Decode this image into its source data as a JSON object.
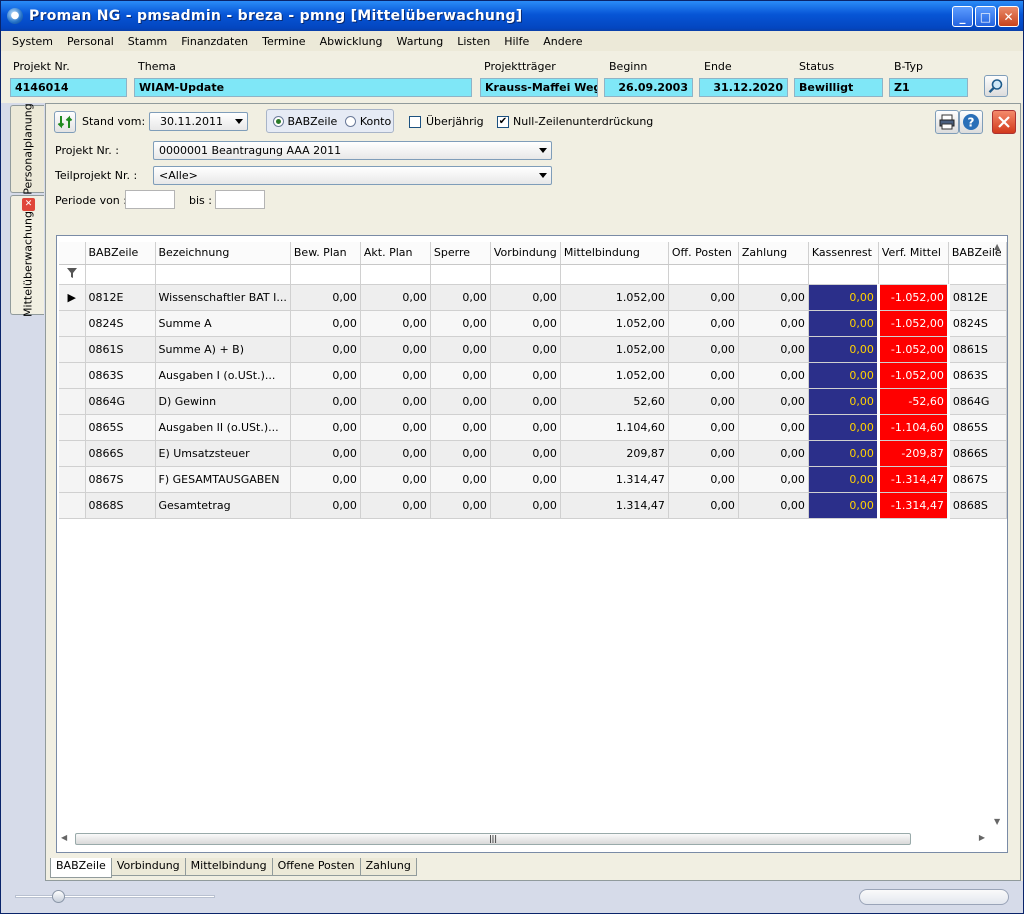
{
  "window": {
    "title": "Proman NG - pmsadmin - breza - pmng [Mittelüberwachung]"
  },
  "menu": [
    "System",
    "Personal",
    "Stamm",
    "Finanzdaten",
    "Termine",
    "Abwicklung",
    "Wartung",
    "Listen",
    "Hilfe",
    "Andere"
  ],
  "header": {
    "projekt_nr_label": "Projekt Nr.",
    "projekt_nr": "4146014",
    "thema_label": "Thema",
    "thema": "WIAM-Update",
    "projekttraeger_label": "Projektträger",
    "projekttraeger": "Krauss-Maffei Wegn",
    "beginn_label": "Beginn",
    "beginn": "26.09.2003",
    "ende_label": "Ende",
    "ende": "31.12.2020",
    "status_label": "Status",
    "status": "Bewilligt",
    "btyp_label": "B-Typ",
    "btyp": "Z1"
  },
  "side_tabs": {
    "personalplanung": "Personalplanung",
    "mittelueberwachung": "Mittelüberwachung"
  },
  "filters": {
    "stand_vom_label": "Stand vom:",
    "stand_vom": "30.11.2011",
    "radio_babzeile": "BABZeile",
    "radio_konto": "Konto",
    "ueberjaehrig": "Überjährig",
    "null_zeilen": "Null-Zeilenunterdrückung",
    "projekt_nr_label": "Projekt Nr. :",
    "projekt_nr": "0000001 Beantragung AAA 2011",
    "teilprojekt_label": "Teilprojekt Nr. :",
    "teilprojekt": "<Alle>",
    "periode_von_label": "Periode von :",
    "bis_label": "bis :"
  },
  "grid": {
    "columns": [
      "BABZeile",
      "Bezeichnung",
      "Bew. Plan",
      "Akt. Plan",
      "Sperre",
      "Vorbindung",
      "Mittelbindung",
      "Off. Posten",
      "Zahlung",
      "Kassenrest",
      "Verf. Mittel",
      "BABZeile"
    ],
    "rows": [
      [
        "0812E",
        "Wissenschaftler BAT I...",
        "0,00",
        "0,00",
        "0,00",
        "0,00",
        "1.052,00",
        "0,00",
        "0,00",
        "0,00",
        "-1.052,00",
        "0812E"
      ],
      [
        "0824S",
        "Summe A",
        "0,00",
        "0,00",
        "0,00",
        "0,00",
        "1.052,00",
        "0,00",
        "0,00",
        "0,00",
        "-1.052,00",
        "0824S"
      ],
      [
        "0861S",
        "Summe A) + B)",
        "0,00",
        "0,00",
        "0,00",
        "0,00",
        "1.052,00",
        "0,00",
        "0,00",
        "0,00",
        "-1.052,00",
        "0861S"
      ],
      [
        "0863S",
        "Ausgaben I (o.USt.)...",
        "0,00",
        "0,00",
        "0,00",
        "0,00",
        "1.052,00",
        "0,00",
        "0,00",
        "0,00",
        "-1.052,00",
        "0863S"
      ],
      [
        "0864G",
        "D) Gewinn",
        "0,00",
        "0,00",
        "0,00",
        "0,00",
        "52,60",
        "0,00",
        "0,00",
        "0,00",
        "-52,60",
        "0864G"
      ],
      [
        "0865S",
        "Ausgaben II (o.USt.)...",
        "0,00",
        "0,00",
        "0,00",
        "0,00",
        "1.104,60",
        "0,00",
        "0,00",
        "0,00",
        "-1.104,60",
        "0865S"
      ],
      [
        "0866S",
        "E) Umsatzsteuer",
        "0,00",
        "0,00",
        "0,00",
        "0,00",
        "209,87",
        "0,00",
        "0,00",
        "0,00",
        "-209,87",
        "0866S"
      ],
      [
        "0867S",
        "F) GESAMTAUSGABEN",
        "0,00",
        "0,00",
        "0,00",
        "0,00",
        "1.314,47",
        "0,00",
        "0,00",
        "0,00",
        "-1.314,47",
        "0867S"
      ],
      [
        "0868S",
        "Gesamtetrag",
        "0,00",
        "0,00",
        "0,00",
        "0,00",
        "1.314,47",
        "0,00",
        "0,00",
        "0,00",
        "-1.314,47",
        "0868S"
      ]
    ]
  },
  "bottom_tabs": [
    "BABZeile",
    "Vorbindung",
    "Mittelbindung",
    "Offene Posten",
    "Zahlung"
  ],
  "colors": {
    "field_highlight": "#7fe7f7",
    "kassenrest_bg": "#2b2f8a",
    "kassenrest_text": "#ffd200",
    "verf_mittel_bg": "#ff0000"
  }
}
